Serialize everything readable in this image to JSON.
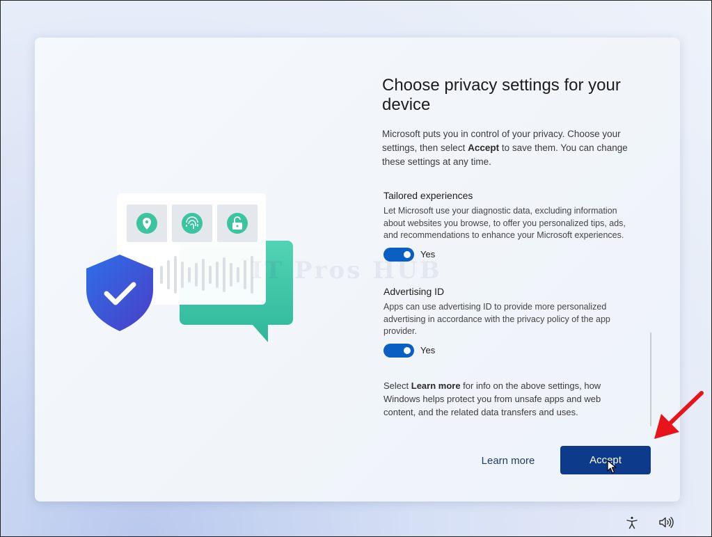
{
  "page": {
    "title": "Choose privacy settings for your device",
    "intro_before": "Microsoft puts you in control of your privacy. Choose your settings, then select ",
    "intro_bold": "Accept",
    "intro_after": " to save them. You can change these settings at any time."
  },
  "settings": [
    {
      "title": "Tailored experiences",
      "description": "Let Microsoft use your diagnostic data, excluding information about websites you browse, to offer you personalized tips, ads, and recommendations to enhance your Microsoft experiences.",
      "toggle_label": "Yes",
      "enabled": true
    },
    {
      "title": "Advertising ID",
      "description": "Apps can use advertising ID to provide more personalized advertising in accordance with the privacy policy of the app provider.",
      "toggle_label": "Yes",
      "enabled": true
    }
  ],
  "footnote": {
    "before": "Select ",
    "bold": "Learn more",
    "after": " for info on the above settings, how Windows helps protect you from unsafe apps and web content, and the related data transfers and uses."
  },
  "buttons": {
    "learn_more": "Learn more",
    "accept": "Accept"
  },
  "watermark": "IT Pros HUB",
  "illustration_icons": [
    "location-pin-icon",
    "fingerprint-icon",
    "unlock-icon",
    "shield-check-icon",
    "chat-bubble-icon",
    "audio-wave-icon"
  ],
  "tray_icons": [
    "accessibility-icon",
    "volume-icon"
  ],
  "colors": {
    "accent": "#0a5fc2",
    "accept_button": "#0d3a8a",
    "shield": "#3b5fd9",
    "teal": "#3ec9a7",
    "annotation_arrow": "#e8141b"
  }
}
